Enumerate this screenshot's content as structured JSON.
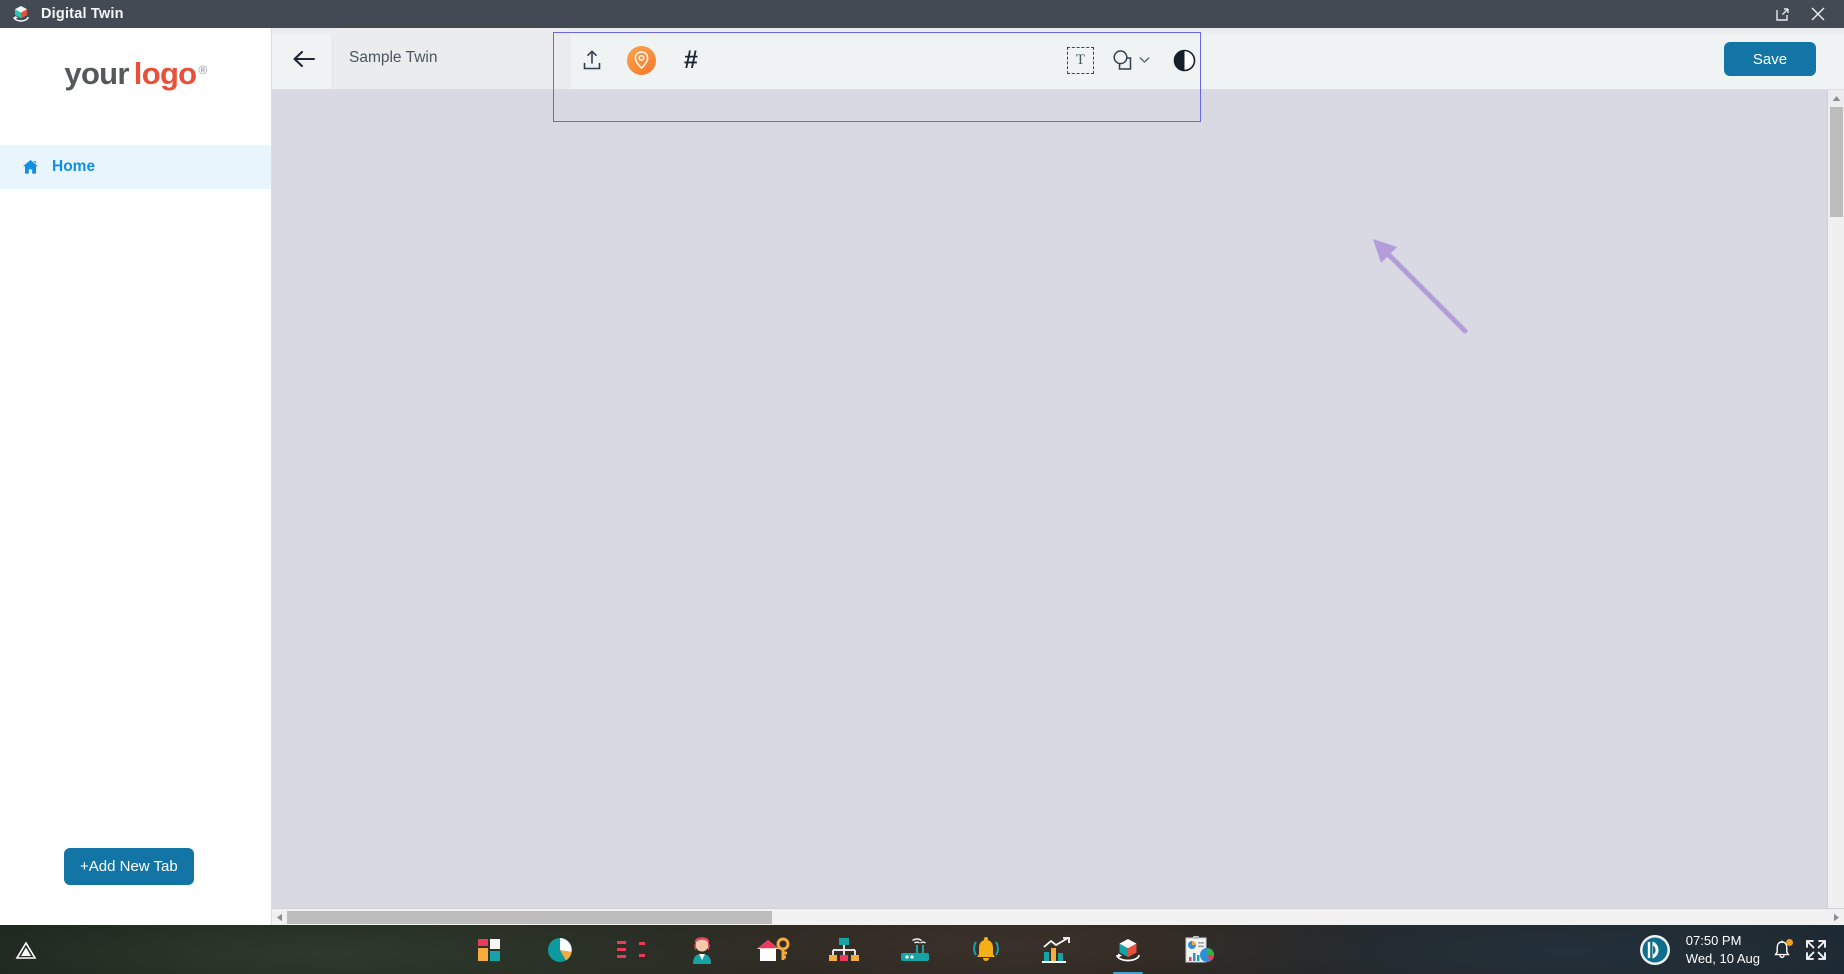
{
  "titlebar": {
    "title": "Digital Twin",
    "logo_icon": "cube-rotate-icon",
    "restore_button": "restore-window-icon",
    "close_button": "close-icon"
  },
  "sidebar": {
    "logo": {
      "part1": "your",
      "part2": "logo",
      "registered": "®"
    },
    "items": [
      {
        "label": "Home",
        "icon": "home-icon",
        "active": true
      }
    ],
    "add_tab_label": "+Add New Tab"
  },
  "header": {
    "back_icon": "back-arrow-icon",
    "tab_label": "Sample Twin",
    "save_label": "Save",
    "toolbar": {
      "left_tools": [
        {
          "name": "upload-icon",
          "title": "Upload"
        },
        {
          "name": "location-pin-icon",
          "title": "Add Marker"
        },
        {
          "name": "hash-icon",
          "title": "Hash",
          "glyph": "#"
        }
      ],
      "right_tools": [
        {
          "name": "text-tool-icon",
          "glyph": "T",
          "title": "Text"
        },
        {
          "name": "shapes-tool-icon",
          "title": "Shapes"
        },
        {
          "name": "contrast-icon",
          "title": "Contrast"
        }
      ]
    }
  },
  "canvas": {
    "annotation": "purple-arrow-annotation",
    "background_color": "#d9d9e3",
    "selection_color": "#6b68e8"
  },
  "scrollbars": {
    "vertical": "vertical-scrollbar",
    "horizontal": "horizontal-scrollbar"
  },
  "taskbar": {
    "left_icon": "triangle-warning-icon",
    "apps": [
      {
        "name": "tiles-icon"
      },
      {
        "name": "pie-chart-icon"
      },
      {
        "name": "flow-diagram-icon"
      },
      {
        "name": "person-icon"
      },
      {
        "name": "home-key-icon"
      },
      {
        "name": "sitemap-icon"
      },
      {
        "name": "wifi-router-icon"
      },
      {
        "name": "bell-alert-icon"
      },
      {
        "name": "trend-chart-icon"
      },
      {
        "name": "digital-twin-cube-icon",
        "active": true
      },
      {
        "name": "report-dashboard-icon"
      }
    ],
    "tray": {
      "media_icon": "media-player-icon",
      "time": "07:50 PM",
      "date": "Wed, 10 Aug",
      "notification_icon": "bell-icon",
      "expand_icon": "expand-icon"
    }
  },
  "colors": {
    "titlebar": "#434a54",
    "accent_blue": "#1275a5",
    "nav_blue": "#1190e3",
    "logo_red": "#e8503a",
    "pin_orange": "#f7782c"
  }
}
